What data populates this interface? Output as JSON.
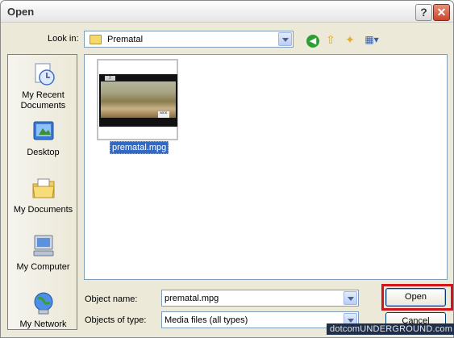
{
  "window": {
    "title": "Open"
  },
  "titlebar_buttons": {
    "help": "?",
    "close": "✕"
  },
  "lookin": {
    "label": "Look in:",
    "value": "Prematal"
  },
  "toolbar": {
    "back_icon": "◀",
    "up_icon": "⇧",
    "newfolder_icon": "✦",
    "views_icon": "▦▾"
  },
  "places": [
    {
      "label": "My Recent Documents",
      "icon": "recent-documents-icon"
    },
    {
      "label": "Desktop",
      "icon": "desktop-icon"
    },
    {
      "label": "My Documents",
      "icon": "documents-folder-icon"
    },
    {
      "label": "My Computer",
      "icon": "computer-icon"
    },
    {
      "label": "My Network",
      "icon": "network-icon"
    }
  ],
  "files": [
    {
      "name": "prematal.mpg",
      "thumb_logo": "2",
      "thumb_badge": "MCK"
    }
  ],
  "object_name": {
    "label": "Object name:",
    "value": "prematal.mpg"
  },
  "object_type": {
    "label": "Objects of type:",
    "value": "Media files (all types)"
  },
  "buttons": {
    "open": "Open",
    "cancel": "Cancel"
  },
  "watermark": "dotcomUNDERGROUND.com",
  "colors": {
    "dialog_bg": "#ECE9D8",
    "selection": "#316ac5",
    "highlight_box": "#d4141a"
  }
}
